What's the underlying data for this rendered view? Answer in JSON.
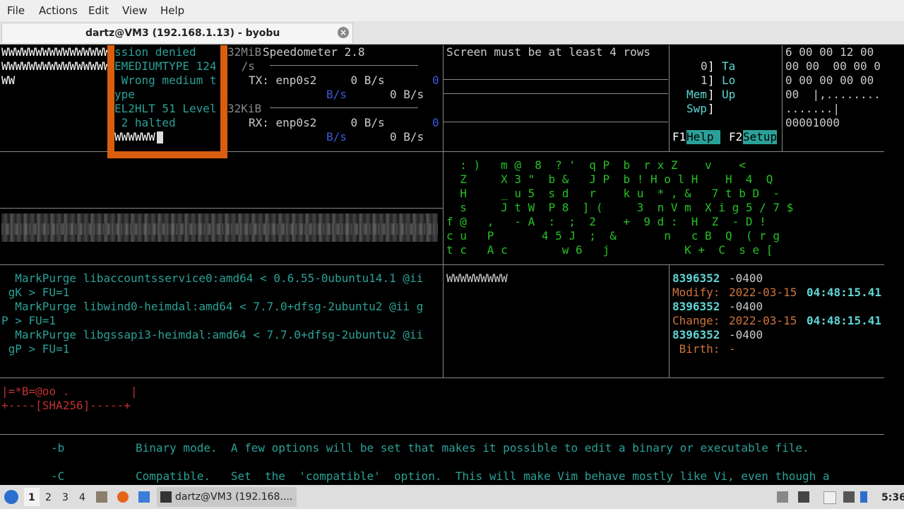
{
  "menubar": {
    "file": "File",
    "actions": "Actions",
    "edit": "Edit",
    "view": "View",
    "help": "Help"
  },
  "tab": {
    "title": "dartz@VM3 (192.168.1.13) - byobu",
    "close": "×"
  },
  "pane1": {
    "lines": [
      "WWWWWWWWWWWWWWWW",
      "WWWWWWWWWWWWWWWW",
      "WW"
    ],
    "overlay": [
      "ssion denied",
      "EMEDIUMTYPE 124",
      " Wrong medium t",
      "ype",
      "EL2HLT 51 Level",
      " 2 halted",
      "WWWWWW"
    ]
  },
  "pane2": {
    "l1a": "32MiB",
    "l1b": "Speedometer 2.8",
    "l2": " /s",
    "tx": "TX: enp0s2     0 B/s",
    "tx_zero": "0",
    "tx_bs": "B/s",
    "tx_bs2": "0 B/s",
    "l4": "32KiB",
    "rx": "RX: enp0s2     0 B/s",
    "rx_zero": "0",
    "rx_bs": "B/s",
    "rx_bs2": "0 B/s"
  },
  "pane3": {
    "text": "Screen must be at least 4 rows"
  },
  "htop": {
    "r0n": "0",
    "r0l": "Ta",
    "r1n": "1",
    "r1l": "Lo",
    "mem": "Mem",
    "up": "Up",
    "swp": "Swp",
    "f1": "F1",
    "f1l": "Help ",
    "f2": "F2",
    "f2l": "Setup"
  },
  "hex": [
    "6 00 00 12 00",
    "00 00  00 00 0",
    "0 00 00 00 00",
    "00  |,........",
    ".......|",
    "00001000"
  ],
  "matrix": [
    "  : )   m @  8  ? '  q P  b  r x Z    v    <",
    "  Z     X 3 \"  b &   J P  b ! H o l H    H  4  Q",
    "  H     _ u 5  s d   r    k u  * , &   7 t b D  -",
    "  s     J t W  P 8  ] (     3  n V m  X i g 5 / 7 $",
    "f @   ,   - A  :  ;  2    +  9 d :  H  Z  - D !",
    "c u   P       4 5 J  ;  &       n   c B  Q  ( r g",
    "t c   A c        w 6   j           K +  C  s e ["
  ],
  "apt": [
    "  MarkPurge libaccountsservice0:amd64 < 0.6.55-0ubuntu14.1 @ii",
    " gK > FU=1",
    "  MarkPurge libwind0-heimdal:amd64 < 7.7.0+dfsg-2ubuntu2 @ii g",
    "P > FU=1",
    "  MarkPurge libgssapi3-heimdal:amd64 < 7.7.0+dfsg-2ubuntu2 @ii",
    " gP > FU=1"
  ],
  "pane_ww": "WWWWWWWWW",
  "stat": {
    "n1": "8396352",
    "z1": "-0400",
    "mod_label": "Modify:",
    "mod_date": "2022-03-15",
    "mod_time": "04:48:15.41",
    "n2": "8396352",
    "z2": "-0400",
    "chg_label": "Change:",
    "chg_date": "2022-03-15",
    "chg_time": "04:48:15.41",
    "n3": "8396352",
    "z3": "-0400",
    "birth_label": " Birth:",
    "birth_val": "-"
  },
  "sha": {
    "l1": "|=*B=@oo .         |",
    "l2": "+----[SHA256]-----+"
  },
  "man": {
    "b_opt": "-b",
    "b_text": "Binary mode.  A few options will be set that makes it possible to edit a binary or executable file.",
    "c_opt": "-C",
    "c_text": "Compatible.   Set  the  'compatible'  option.  This will make Vim behave mostly like Vi, even though a"
  },
  "taskbar": {
    "ws1": "1",
    "ws2": "2",
    "ws3": "3",
    "ws4": "4",
    "task": "dartz@VM3 (192.168....",
    "clock": "5:36"
  },
  "colors": {
    "accent": "#d95f0e",
    "cyan": "#2aa198",
    "green": "#26c026"
  }
}
